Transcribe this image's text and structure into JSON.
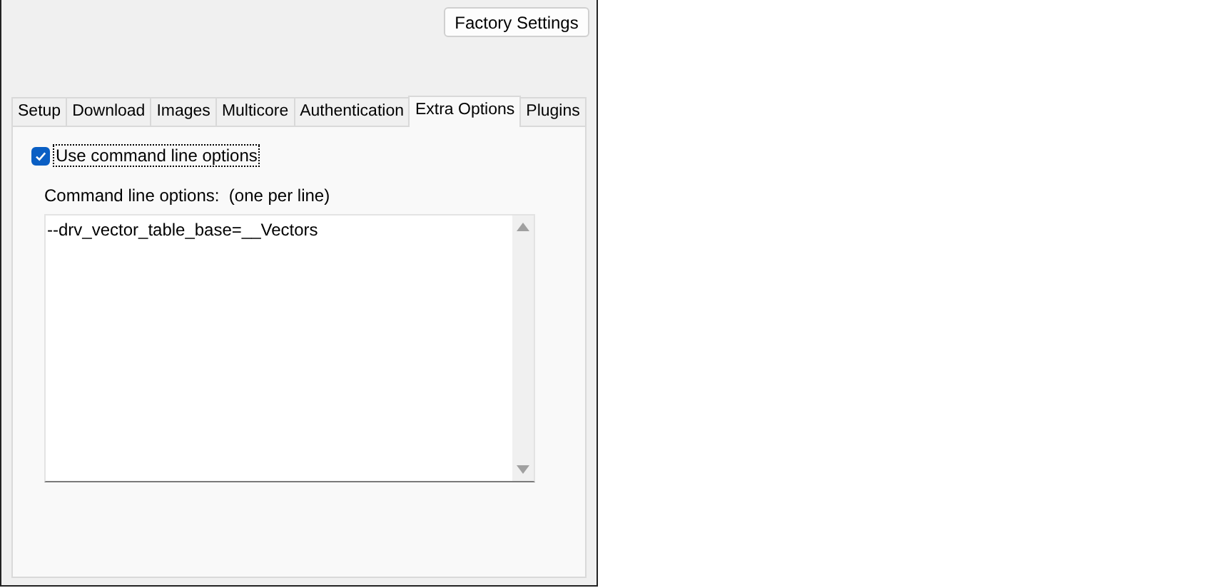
{
  "buttons": [
    {
      "label": "Factory Settings"
    }
  ],
  "tabs": [
    {
      "label": "Setup",
      "selected": false
    },
    {
      "label": "Download",
      "selected": false
    },
    {
      "label": "Images",
      "selected": false
    },
    {
      "label": "Multicore",
      "selected": false
    },
    {
      "label": "Authentication",
      "selected": false
    },
    {
      "label": "Extra Options",
      "selected": true
    },
    {
      "label": "Plugins",
      "selected": false
    }
  ],
  "use_command_line_options": {
    "label": "Use command line options",
    "checked": true
  },
  "command_line_options": {
    "label": "Command line options:  (one per line)",
    "value": "--drv_vector_table_base=__Vectors"
  }
}
